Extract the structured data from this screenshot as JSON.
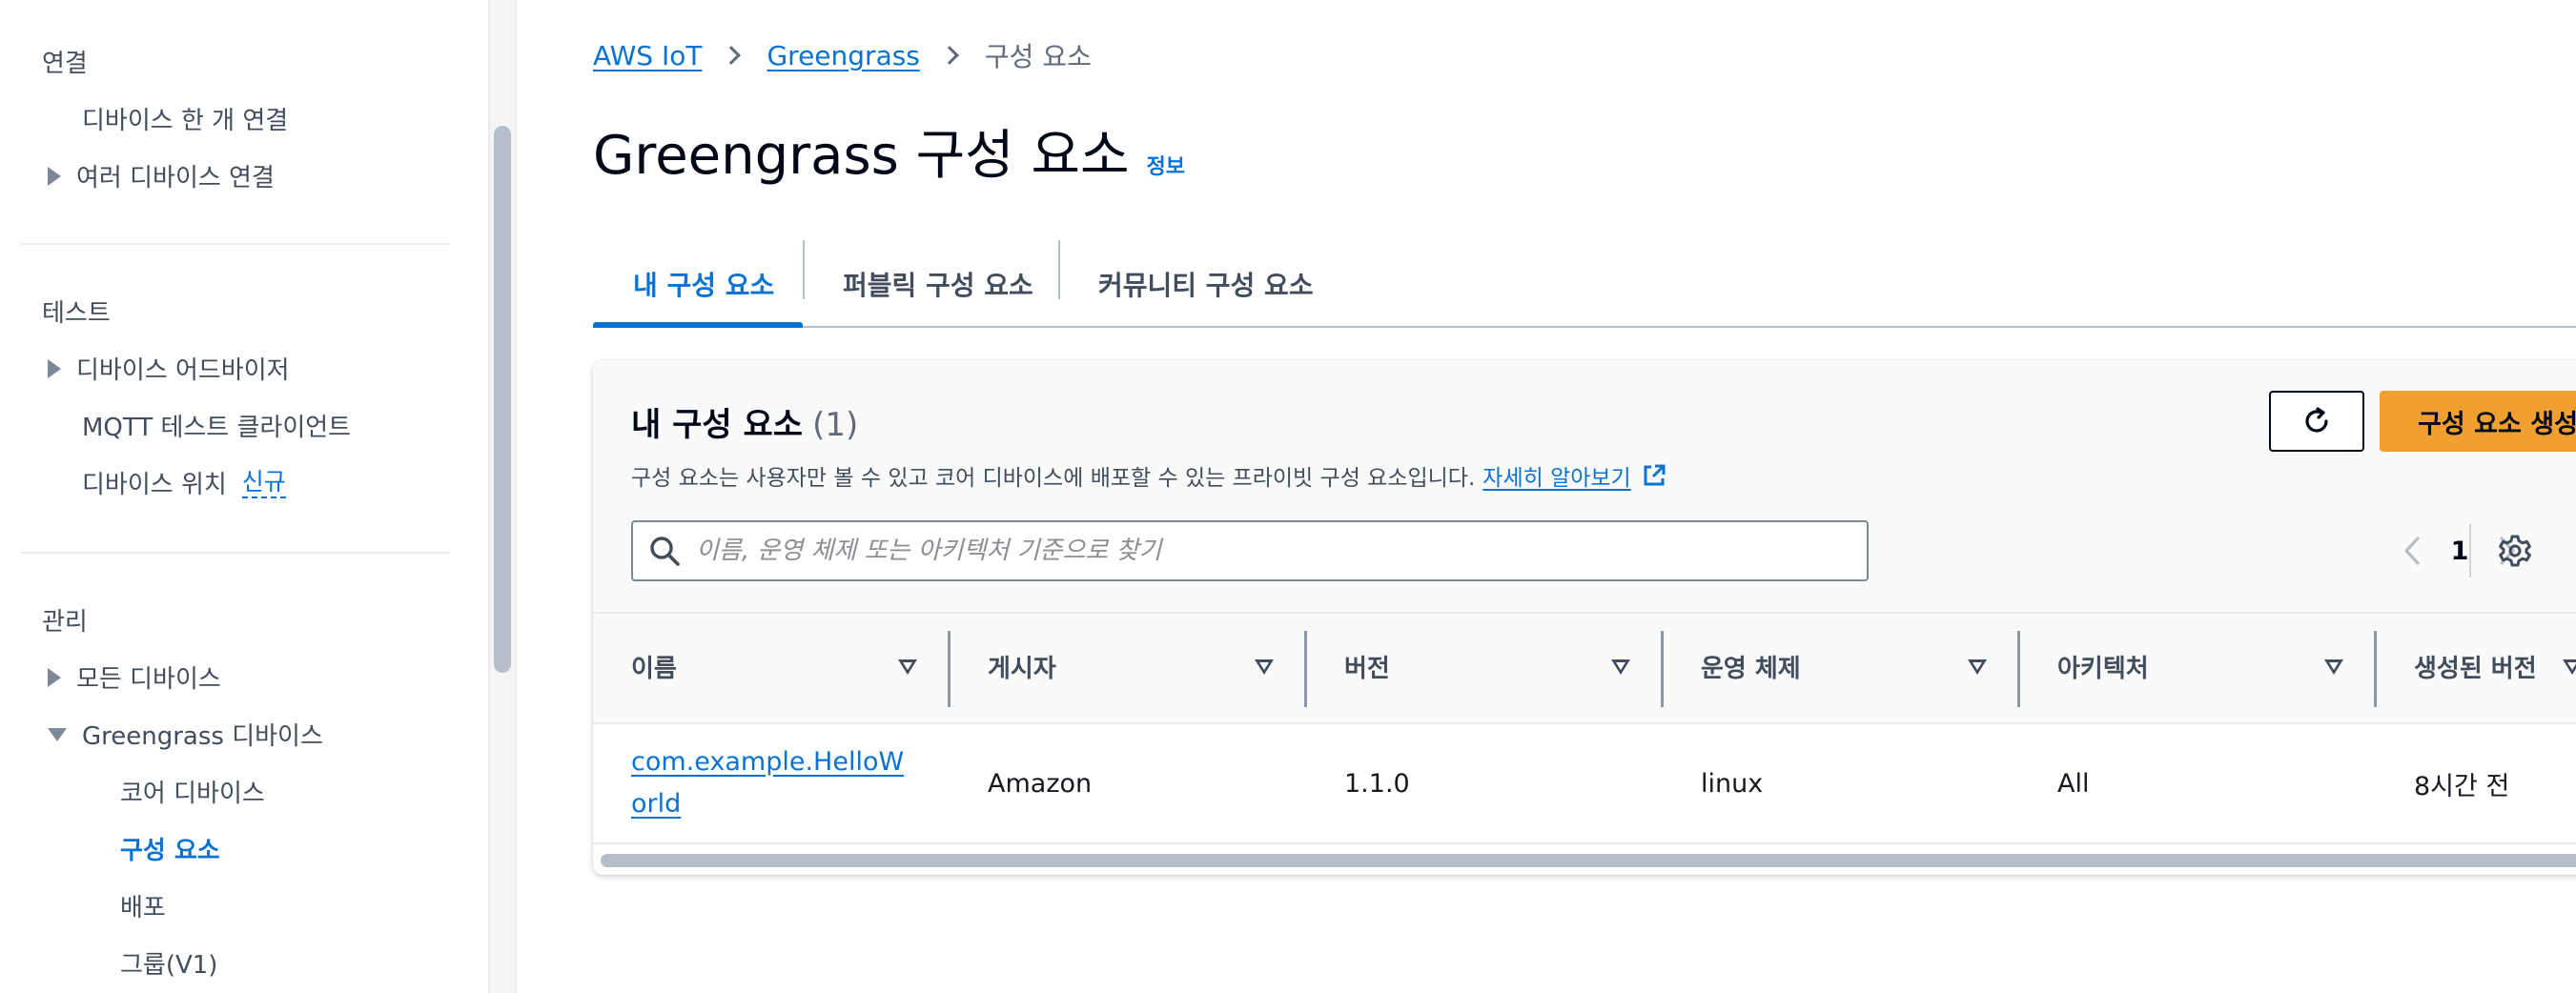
{
  "sidebar": {
    "sections": [
      {
        "title": "연결",
        "items": [
          {
            "label": "디바이스 한 개 연결"
          },
          {
            "label": "여러 디바이스 연결"
          }
        ]
      },
      {
        "title": "테스트",
        "items": [
          {
            "label": "디바이스 어드바이저"
          },
          {
            "label": "MQTT 테스트 클라이언트"
          },
          {
            "label": "디바이스 위치",
            "badge": "신규"
          }
        ]
      },
      {
        "title": "관리",
        "items": [
          {
            "label": "모든 디바이스"
          },
          {
            "label": "Greengrass 디바이스"
          },
          {
            "label": "코어 디바이스"
          },
          {
            "label": "구성 요소"
          },
          {
            "label": "배포"
          },
          {
            "label": "그룹(V1)"
          }
        ]
      }
    ]
  },
  "breadcrumb": {
    "items": [
      "AWS IoT",
      "Greengrass"
    ],
    "current": "구성 요소"
  },
  "page": {
    "title": "Greengrass 구성 요소",
    "info": "정보"
  },
  "tabs": [
    {
      "label": "내 구성 요소",
      "active": true
    },
    {
      "label": "퍼블릭 구성 요소",
      "active": false
    },
    {
      "label": "커뮤니티 구성 요소",
      "active": false
    }
  ],
  "panel": {
    "title": "내 구성 요소",
    "count": "(1)",
    "description": "구성 요소는 사용자만 볼 수 있고 코어 디바이스에 배포할 수 있는 프라이빗 구성 요소입니다.",
    "learn_more": "자세히 알아보기",
    "create_label": "구성 요소 생성",
    "search_placeholder": "이름, 운영 체제 또는 아키텍처 기준으로 찾기",
    "search_value": "",
    "page_number": "1"
  },
  "table": {
    "columns": [
      "이름",
      "게시자",
      "버전",
      "운영 체제",
      "아키텍처",
      "생성된 버전"
    ],
    "rows": [
      {
        "name": "com.example.HelloWorld",
        "publisher": "Amazon",
        "version": "1.1.0",
        "os": "linux",
        "architecture": "All",
        "created": "8시간 전"
      }
    ]
  },
  "colors": {
    "link": "#0972d3",
    "primary_button": "#f0a030",
    "text": "#16191f",
    "muted": "#414d5c"
  },
  "icons": {
    "refresh": "refresh-icon",
    "search": "search-icon",
    "settings": "gear-icon",
    "external": "external-link-icon",
    "pager_prev": "chevron-left-icon",
    "pager_next": "chevron-right-icon"
  }
}
